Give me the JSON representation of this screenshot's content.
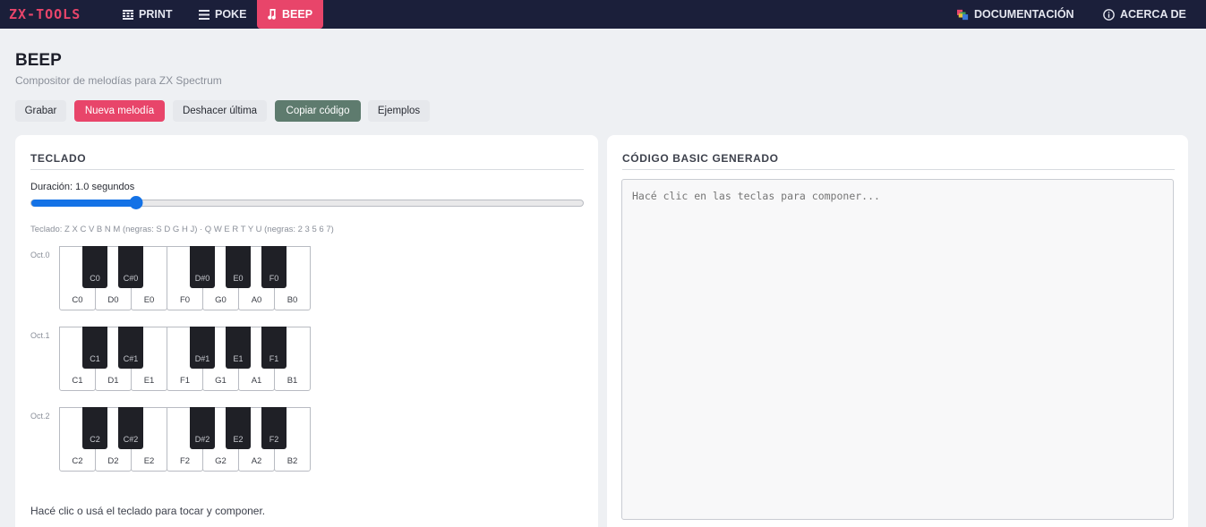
{
  "nav": {
    "logo": "ZX-TOOLS",
    "items": [
      {
        "label": "PRINT",
        "icon": "grid-icon"
      },
      {
        "label": "POKE",
        "icon": "menu-icon"
      },
      {
        "label": "BEEP",
        "icon": "music-note-icon"
      }
    ],
    "active": "BEEP",
    "right_items": [
      {
        "label": "DOCUMENTACIÓN",
        "icon": "color-blocks-icon"
      },
      {
        "label": "ACERCA DE",
        "icon": "info-icon"
      }
    ]
  },
  "page": {
    "title": "BEEP",
    "subtitle": "Compositor de melodías para ZX Spectrum"
  },
  "toolbar": {
    "record": "Grabar",
    "new_melody": "Nueva melodía",
    "undo_last": "Deshacer última",
    "copy_code": "Copiar código",
    "examples": "Ejemplos"
  },
  "keyboard_panel": {
    "heading": "TECLADO",
    "duration_label": "Duración: 1.0 segundos",
    "duration_value": 1.0,
    "duration_slider_fraction": 0.19,
    "hint": "Teclado: Z X C V B N M (negras: S D G H J) · Q W E R T Y U (negras: 2 3 5 6 7)",
    "octaves": [
      {
        "label": "Oct.0",
        "white": [
          "C0",
          "D0",
          "E0",
          "F0",
          "G0",
          "A0",
          "B0"
        ],
        "black": [
          "C0",
          "C#0",
          "D#0",
          "E0",
          "F0"
        ]
      },
      {
        "label": "Oct.1",
        "white": [
          "C1",
          "D1",
          "E1",
          "F1",
          "G1",
          "A1",
          "B1"
        ],
        "black": [
          "C1",
          "C#1",
          "D#1",
          "E1",
          "F1"
        ]
      },
      {
        "label": "Oct.2",
        "white": [
          "C2",
          "D2",
          "E2",
          "F2",
          "G2",
          "A2",
          "B2"
        ],
        "black": [
          "C2",
          "C#2",
          "D#2",
          "E2",
          "F2"
        ]
      }
    ],
    "footer": "Hacé clic o usá el teclado para tocar y componer."
  },
  "code_panel": {
    "heading": "CÓDIGO BASIC GENERADO",
    "placeholder": "Hacé clic en las teclas para componer...",
    "value": ""
  },
  "colors": {
    "nav_bg": "#1b1f3a",
    "accent": "#e8456a",
    "copy_button": "#5e7b6e",
    "slider": "#1472e6"
  }
}
